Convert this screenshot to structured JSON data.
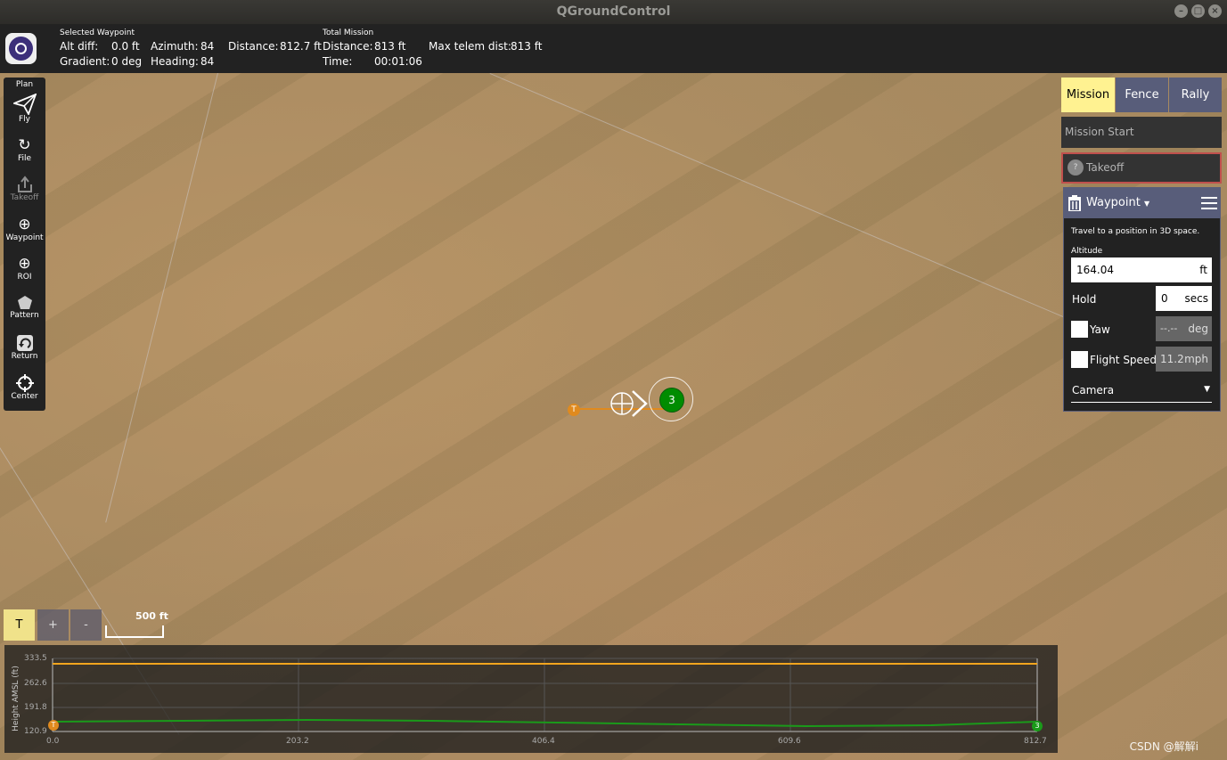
{
  "window": {
    "title": "QGroundControl"
  },
  "topbar": {
    "selected_waypoint": {
      "heading": "Selected Waypoint",
      "alt_diff_label": "Alt diff:",
      "alt_diff_value": "0.0 ft",
      "azimuth_label": "Azimuth:",
      "azimuth_value": "84",
      "distance_label": "Distance:",
      "distance_value": "812.7 ft",
      "gradient_label": "Gradient:",
      "gradient_value": "0 deg",
      "heading_label": "Heading:",
      "heading_value": "84"
    },
    "total_mission": {
      "heading": "Total Mission",
      "distance_label": "Distance:",
      "distance_value": "813 ft",
      "time_label": "Time:",
      "time_value": "00:01:06",
      "max_telem_label": "Max telem dist:",
      "max_telem_value": "813 ft"
    }
  },
  "toolstrip": {
    "plan_label": "Plan",
    "items": [
      {
        "label": "Fly",
        "icon": "paper-plane-icon"
      },
      {
        "label": "File",
        "icon": "sync-icon"
      },
      {
        "label": "Takeoff",
        "icon": "takeoff-icon",
        "disabled": true
      },
      {
        "label": "Waypoint",
        "icon": "plus-circle-icon"
      },
      {
        "label": "ROI",
        "icon": "plus-circle-icon"
      },
      {
        "label": "Pattern",
        "icon": "pattern-icon"
      },
      {
        "label": "Return",
        "icon": "return-icon"
      },
      {
        "label": "Center",
        "icon": "crosshair-icon"
      }
    ]
  },
  "right_panel": {
    "tabs": [
      {
        "label": "Mission",
        "active": true
      },
      {
        "label": "Fence",
        "active": false
      },
      {
        "label": "Rally",
        "active": false
      }
    ],
    "mission_start": "Mission Start",
    "takeoff": {
      "label": "Takeoff",
      "badge": "?"
    },
    "waypoint": {
      "title": "Waypoint",
      "description": "Travel to a position in 3D space.",
      "altitude_label": "Altitude",
      "altitude_value": "164.04",
      "altitude_unit": "ft",
      "hold_label": "Hold",
      "hold_value": "0",
      "hold_unit": "secs",
      "yaw_label": "Yaw",
      "yaw_value": "--.--",
      "yaw_unit": "deg",
      "speed_label": "Flight Speed",
      "speed_value": "11.2",
      "speed_unit": "mph",
      "camera_label": "Camera"
    }
  },
  "map": {
    "takeoff_marker": "T",
    "waypoint_marker": "3",
    "zoom_buttons": [
      "T",
      "+",
      "-"
    ],
    "scale_label": "500 ft"
  },
  "profile": {
    "ylabel": "Height AMSL (ft)",
    "y_ticks": [
      "333.5",
      "262.6",
      "191.8",
      "120.9"
    ],
    "x_ticks": [
      "0.0",
      "203.2",
      "406.4",
      "609.6",
      "812.7"
    ],
    "start_marker": "T",
    "end_marker": "3"
  },
  "watermark": "CSDN @解解i",
  "colors": {
    "accent_tab": "#fff291",
    "panel_header": "#585d7a",
    "waypoint_green": "#008c00",
    "takeoff_orange": "#e08a1e",
    "mission_line": "#f2a51e",
    "terrain_line": "#1a9a1a"
  }
}
